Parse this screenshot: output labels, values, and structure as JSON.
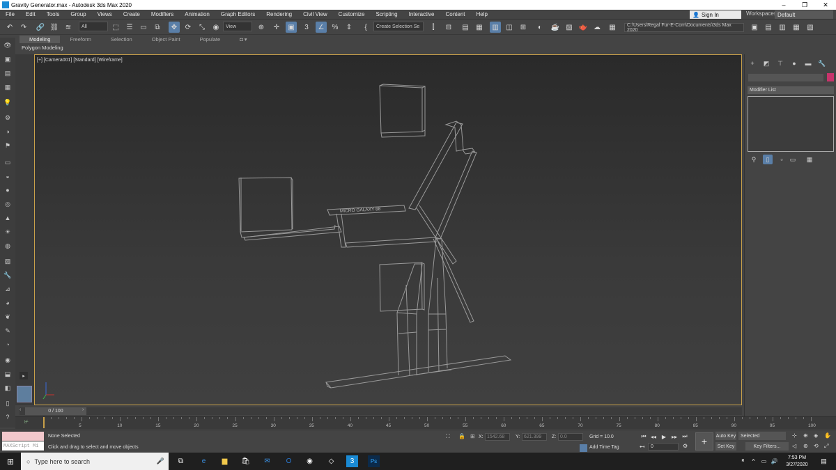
{
  "window": {
    "title": "Gravity Generator.max - Autodesk 3ds Max 2020",
    "controls": [
      "–",
      "❐",
      "✕"
    ]
  },
  "menu": {
    "items": [
      "File",
      "Edit",
      "Tools",
      "Group",
      "Views",
      "Create",
      "Modifiers",
      "Animation",
      "Graph Editors",
      "Rendering",
      "Civil View",
      "Customize",
      "Scripting",
      "Interactive",
      "Content",
      "Help"
    ],
    "sign_in": "Sign In",
    "workspaces_label": "Workspaces:",
    "workspace_value": "Default"
  },
  "toolbar": {
    "filter": "All",
    "ref_coord": "View",
    "selection_set": "Create Selection Se",
    "path": "C:\\Users\\Regal Fur-E-Com\\Documents\\3ds Max 2020"
  },
  "ribbon": {
    "tabs": [
      "Modeling",
      "Freeform",
      "Selection",
      "Object Paint",
      "Populate"
    ],
    "sub_label": "Polygon Modeling"
  },
  "viewport": {
    "label": "[+] [Camera001] [Standard] [Wireframe]",
    "sign_text": "MICRO GALAXY 88"
  },
  "command_panel": {
    "modifier_list": "Modifier List",
    "color": "#c8336b"
  },
  "timeline": {
    "slider": "0 / 100",
    "ticks": [
      "5",
      "10",
      "15",
      "20",
      "25",
      "30",
      "35",
      "40",
      "45",
      "50",
      "55",
      "60",
      "65",
      "70",
      "75",
      "80",
      "85",
      "90",
      "95",
      "100"
    ]
  },
  "status": {
    "maxscript": "MAXScript Mi",
    "selection": "None Selected",
    "prompt": "Click and drag to select and move objects",
    "x_label": "X:",
    "x_value": "1542.68",
    "y_label": "Y:",
    "y_value": "621.399",
    "z_label": "Z:",
    "z_value": "0.0",
    "grid": "Grid = 10.0",
    "add_time_tag": "Add Time Tag",
    "frame": "0",
    "auto_key": "Auto Key",
    "set_key": "Set Key",
    "key_mode": "Selected",
    "key_filters": "Key Filters..."
  },
  "taskbar": {
    "search_placeholder": "Type here to search",
    "time": "7:53 PM",
    "date": "3/27/2020"
  }
}
